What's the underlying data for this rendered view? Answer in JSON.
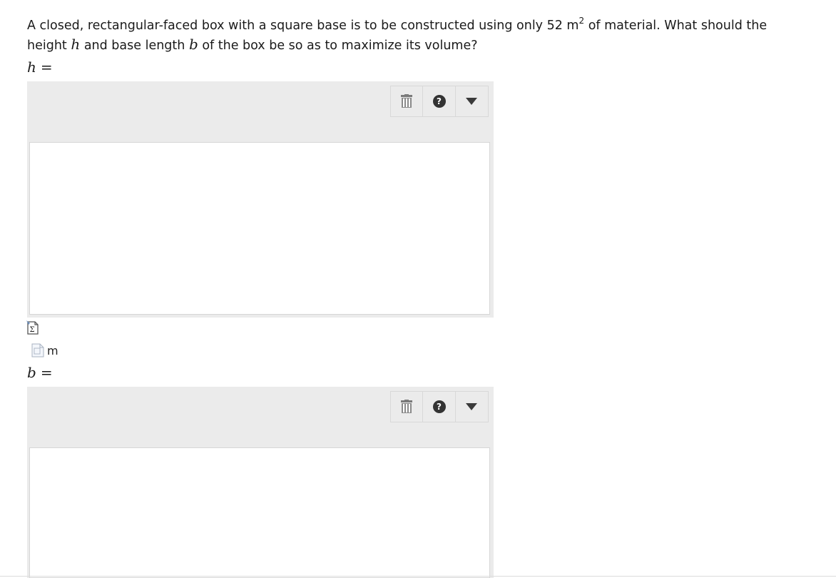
{
  "question": {
    "text_1": "A closed, rectangular-faced box with a square base is to be constructed using only 52 m",
    "sup": "2",
    "text_2": " of material. What should the height ",
    "var_h": "h",
    "text_3": " and base length ",
    "var_b": "b",
    "text_4": " of the box be so as to maximize its volume?"
  },
  "answer_h": {
    "variable": "h",
    "equals": "=",
    "input_value": "",
    "toolbar": {
      "delete_icon": "trash-icon",
      "help_icon": "help-icon",
      "help_glyph": "?",
      "dropdown_icon": "dropdown-arrow-icon"
    },
    "unit": "m"
  },
  "answer_b": {
    "variable": "b",
    "equals": "=",
    "input_value": "",
    "toolbar": {
      "delete_icon": "trash-icon",
      "help_icon": "help-icon",
      "help_glyph": "?",
      "dropdown_icon": "dropdown-arrow-icon"
    }
  }
}
